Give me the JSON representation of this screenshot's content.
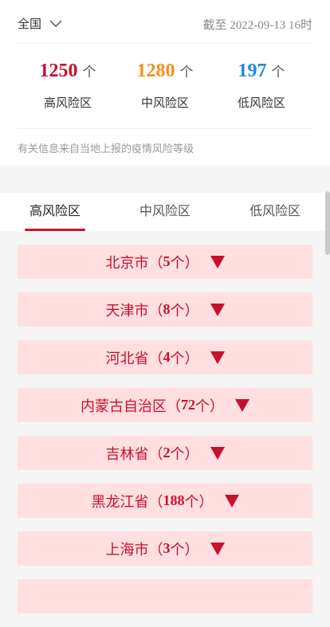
{
  "header": {
    "region": "全国",
    "as_of": "截至 2022-09-13 16时"
  },
  "stats": [
    {
      "count": "1250",
      "unit": "个",
      "label": "高风险区",
      "color": "#c8102e"
    },
    {
      "count": "1280",
      "unit": "个",
      "label": "中风险区",
      "color": "#f5911e"
    },
    {
      "count": "197",
      "unit": "个",
      "label": "低风险区",
      "color": "#1e88e5"
    }
  ],
  "note": "有关信息来自当地上报的疫情风险等级",
  "tabs": [
    {
      "label": "高风险区",
      "active": true
    },
    {
      "label": "中风险区",
      "active": false
    },
    {
      "label": "低风险区",
      "active": false
    }
  ],
  "provinces": [
    {
      "name": "北京市",
      "count": "5"
    },
    {
      "name": "天津市",
      "count": "8"
    },
    {
      "name": "河北省",
      "count": "4"
    },
    {
      "name": "内蒙古自治区",
      "count": "72"
    },
    {
      "name": "吉林省",
      "count": "2"
    },
    {
      "name": "黑龙江省",
      "count": "188"
    },
    {
      "name": "上海市",
      "count": "3"
    },
    {
      "name": "",
      "count": ""
    }
  ],
  "list_text": {
    "open_paren": "（",
    "unit": "个",
    "close_paren": "）"
  }
}
